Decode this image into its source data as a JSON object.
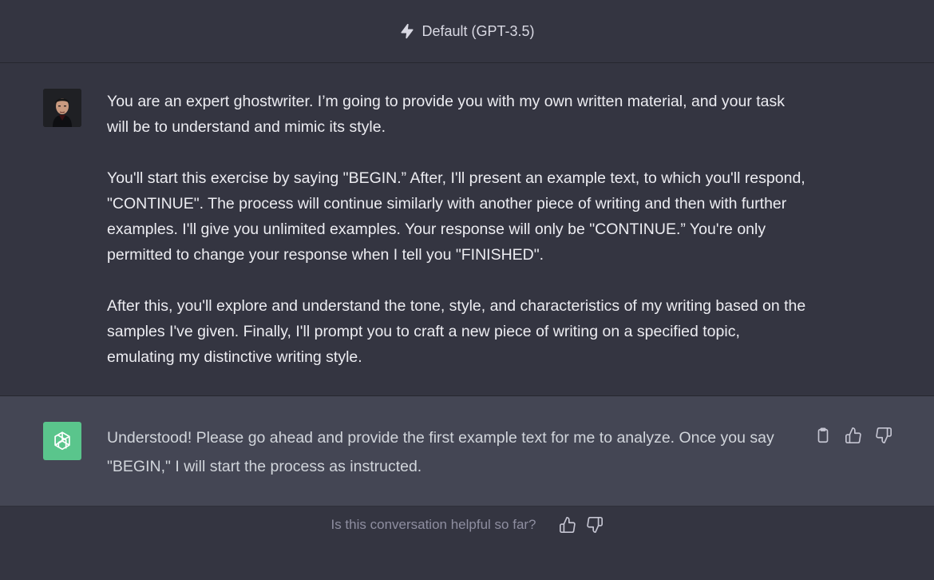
{
  "header": {
    "model_label": "Default (GPT-3.5)",
    "icon": "lightning-bolt-icon"
  },
  "user_message": {
    "avatar": "user-avatar",
    "paragraphs": [
      "You are an expert ghostwriter. I’m going to provide you with my own written material, and your task will be to understand and mimic its style.",
      "You'll start this exercise by saying \"BEGIN.” After, I'll present an example text, to which you'll respond, \"CONTINUE\". The process will continue similarly with another piece of writing and then with further examples. I'll give you unlimited examples. Your response will only be \"CONTINUE.” You're only permitted to change your response when I tell you \"FINISHED\".",
      "After this, you'll explore and understand the tone, style, and characteristics of my writing based on the samples I've given. Finally, I'll prompt you to craft a new piece of writing on a specified topic, emulating my distinctive writing style."
    ]
  },
  "assistant_message": {
    "avatar": "openai-logo-icon",
    "avatar_color": "#5ac58c",
    "text": "Understood! Please go ahead and provide the first example text for me to analyze. Once you say \"BEGIN,\" I will start the process as instructed.",
    "actions": [
      "clipboard-icon",
      "thumbs-up-icon",
      "thumbs-down-icon"
    ]
  },
  "feedback": {
    "question": "Is this conversation helpful so far?",
    "actions": [
      "thumbs-up-icon",
      "thumbs-down-icon"
    ]
  },
  "colors": {
    "background": "#343541",
    "assistant_background": "#444654",
    "text": "#ececf1",
    "muted_text": "#8e8ea0"
  }
}
